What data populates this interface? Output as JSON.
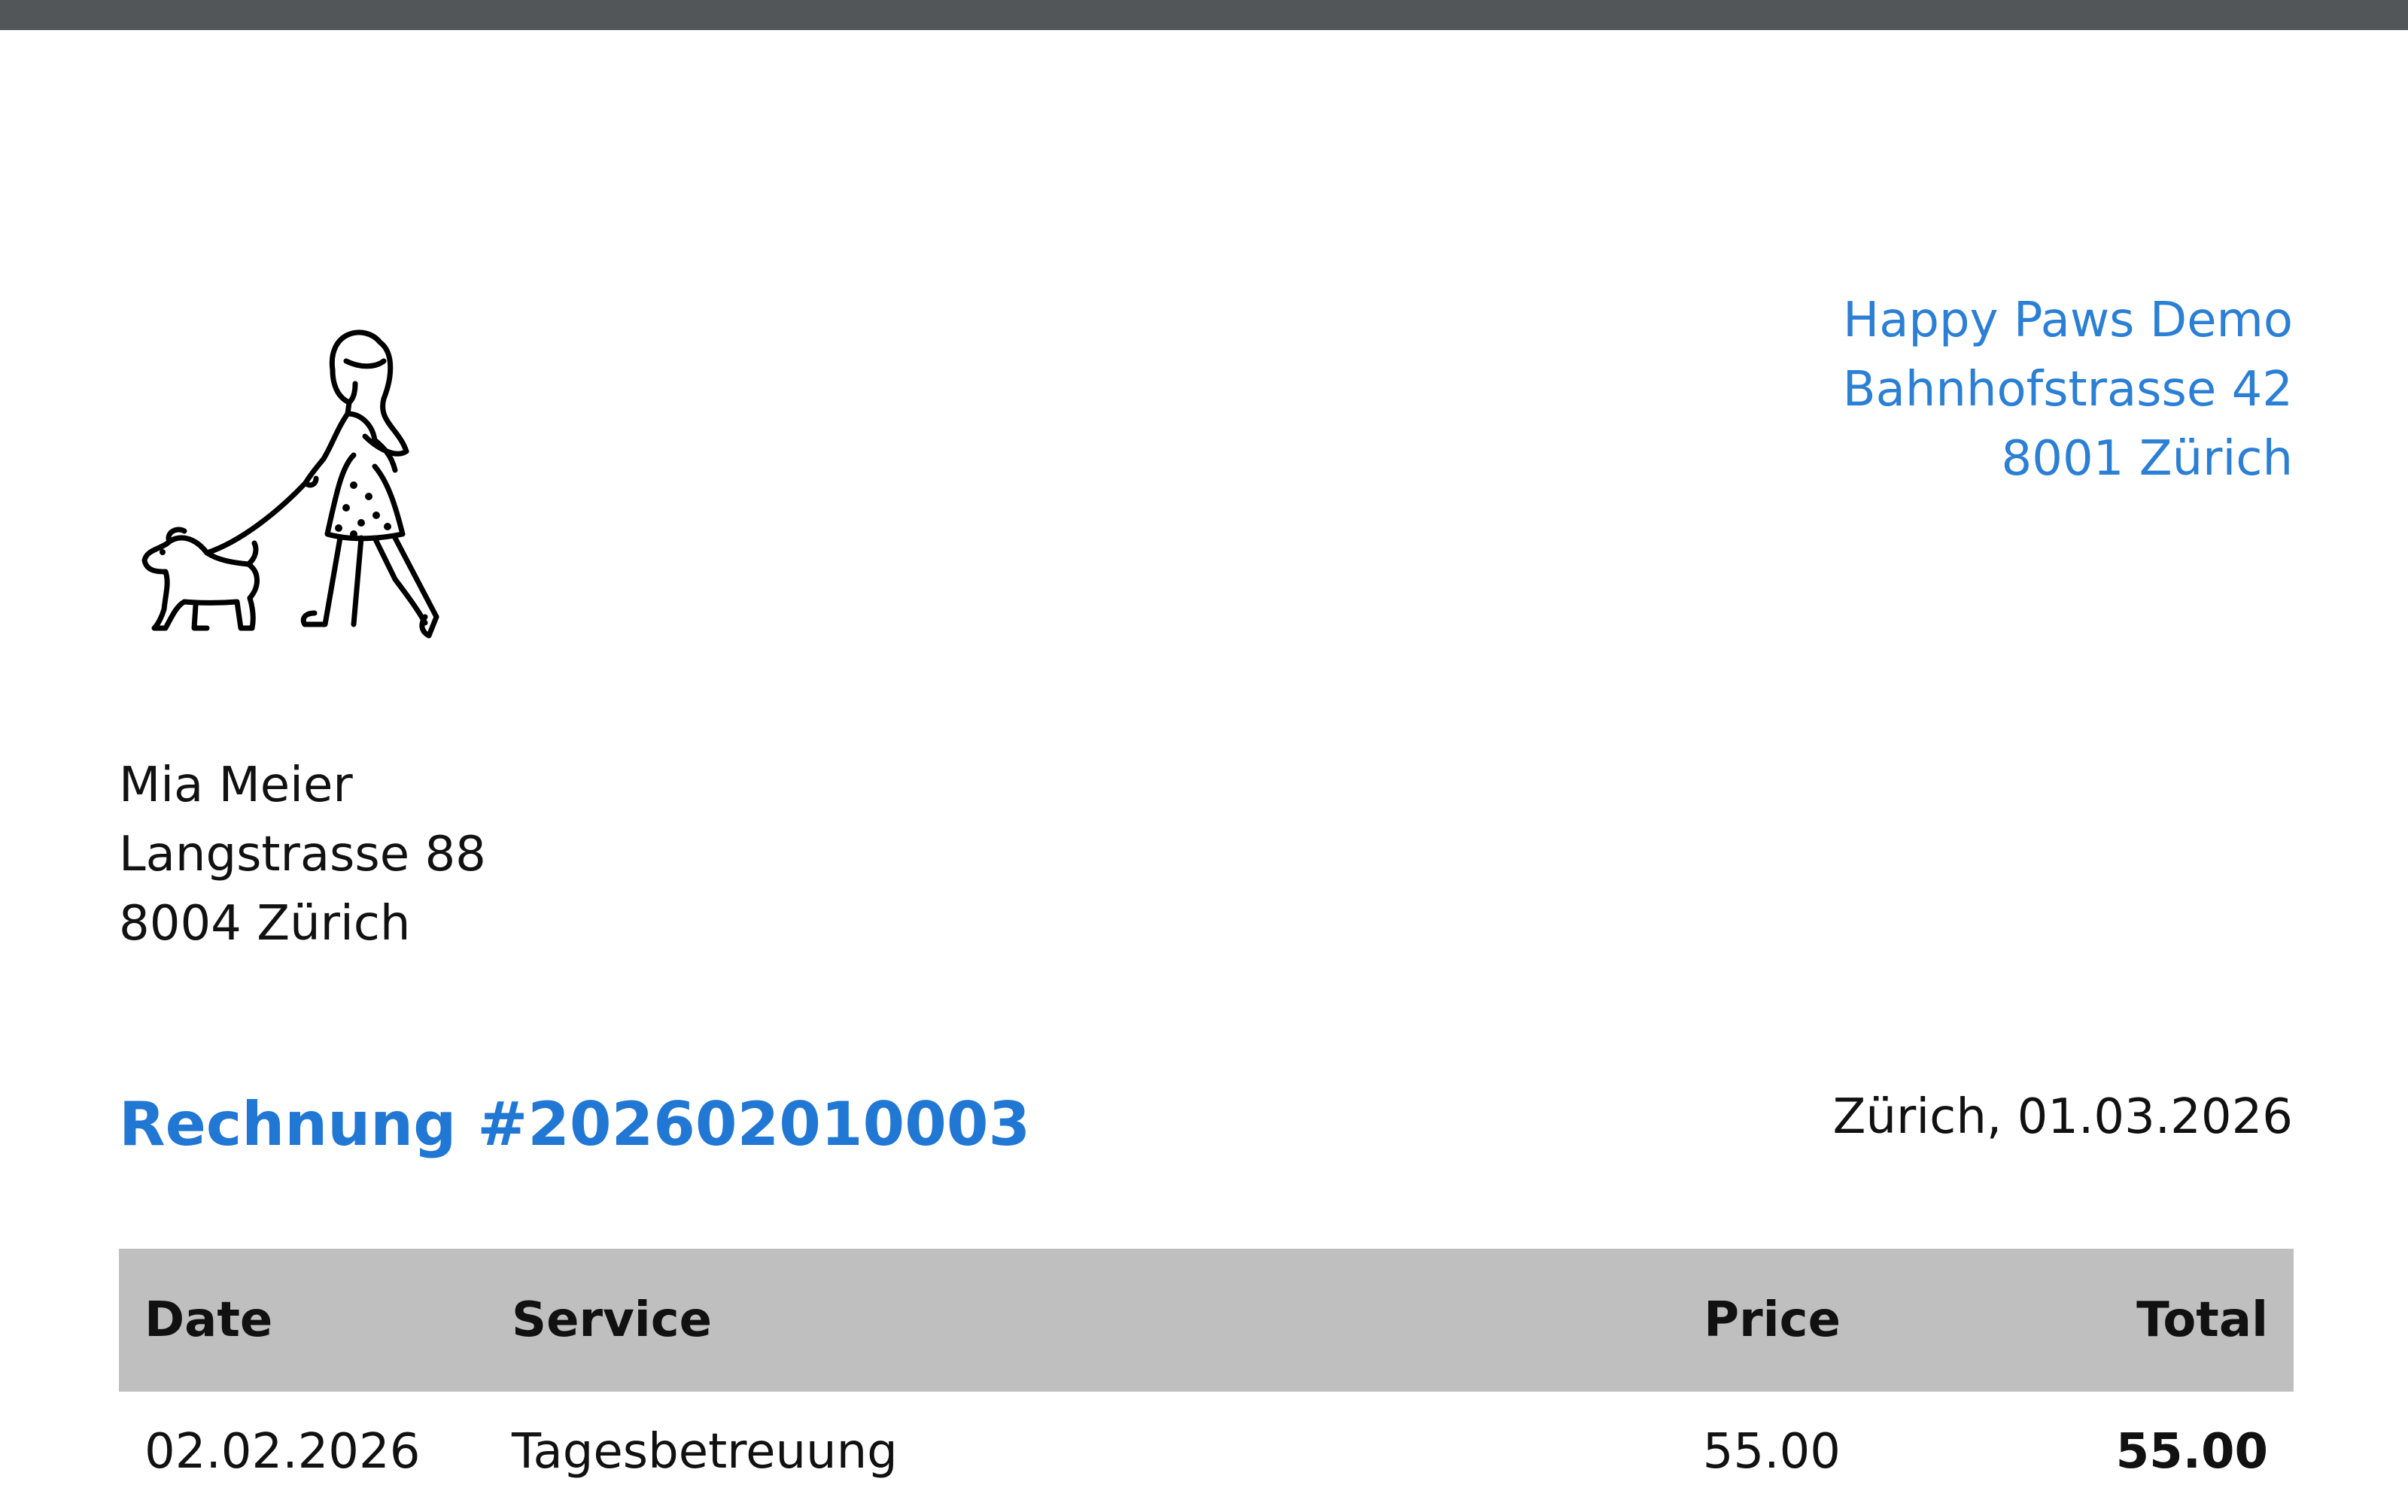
{
  "sender": {
    "name": "Happy Paws Demo",
    "street": "Bahnhofstrasse 42",
    "city": "8001 Zürich"
  },
  "recipient": {
    "name": "Mia Meier",
    "street": "Langstrasse 88",
    "city": "8004 Zürich"
  },
  "invoice": {
    "title": "Rechnung #202602010003",
    "place_date": "Zürich, 01.03.2026"
  },
  "table": {
    "headers": {
      "date": "Date",
      "service": "Service",
      "price": "Price",
      "total": "Total"
    },
    "rows": [
      {
        "date": "02.02.2026",
        "service": "Tagesbetreuung",
        "price": "55.00",
        "total": "55.00"
      }
    ]
  },
  "logo": {
    "icon": "dog-walker-icon"
  },
  "colors": {
    "accent": "#2177d4",
    "top_bar": "#535659",
    "table_header": "#bfbfbf"
  }
}
